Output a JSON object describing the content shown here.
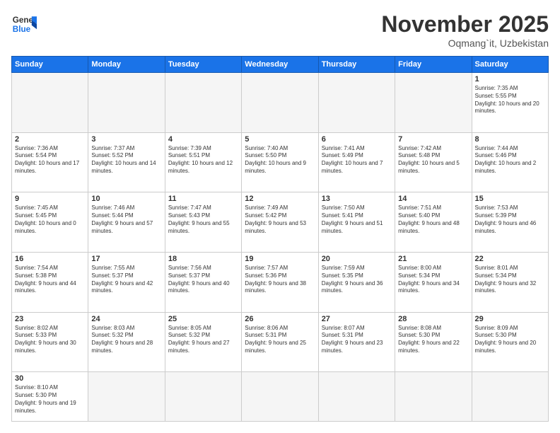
{
  "header": {
    "logo_general": "General",
    "logo_blue": "Blue",
    "month_title": "November 2025",
    "location": "Oqmang`it, Uzbekistan"
  },
  "days_of_week": [
    "Sunday",
    "Monday",
    "Tuesday",
    "Wednesday",
    "Thursday",
    "Friday",
    "Saturday"
  ],
  "weeks": [
    [
      {
        "num": "",
        "info": ""
      },
      {
        "num": "",
        "info": ""
      },
      {
        "num": "",
        "info": ""
      },
      {
        "num": "",
        "info": ""
      },
      {
        "num": "",
        "info": ""
      },
      {
        "num": "",
        "info": ""
      },
      {
        "num": "1",
        "info": "Sunrise: 7:35 AM\nSunset: 5:55 PM\nDaylight: 10 hours and 20 minutes."
      }
    ],
    [
      {
        "num": "2",
        "info": "Sunrise: 7:36 AM\nSunset: 5:54 PM\nDaylight: 10 hours and 17 minutes."
      },
      {
        "num": "3",
        "info": "Sunrise: 7:37 AM\nSunset: 5:52 PM\nDaylight: 10 hours and 14 minutes."
      },
      {
        "num": "4",
        "info": "Sunrise: 7:39 AM\nSunset: 5:51 PM\nDaylight: 10 hours and 12 minutes."
      },
      {
        "num": "5",
        "info": "Sunrise: 7:40 AM\nSunset: 5:50 PM\nDaylight: 10 hours and 9 minutes."
      },
      {
        "num": "6",
        "info": "Sunrise: 7:41 AM\nSunset: 5:49 PM\nDaylight: 10 hours and 7 minutes."
      },
      {
        "num": "7",
        "info": "Sunrise: 7:42 AM\nSunset: 5:48 PM\nDaylight: 10 hours and 5 minutes."
      },
      {
        "num": "8",
        "info": "Sunrise: 7:44 AM\nSunset: 5:46 PM\nDaylight: 10 hours and 2 minutes."
      }
    ],
    [
      {
        "num": "9",
        "info": "Sunrise: 7:45 AM\nSunset: 5:45 PM\nDaylight: 10 hours and 0 minutes."
      },
      {
        "num": "10",
        "info": "Sunrise: 7:46 AM\nSunset: 5:44 PM\nDaylight: 9 hours and 57 minutes."
      },
      {
        "num": "11",
        "info": "Sunrise: 7:47 AM\nSunset: 5:43 PM\nDaylight: 9 hours and 55 minutes."
      },
      {
        "num": "12",
        "info": "Sunrise: 7:49 AM\nSunset: 5:42 PM\nDaylight: 9 hours and 53 minutes."
      },
      {
        "num": "13",
        "info": "Sunrise: 7:50 AM\nSunset: 5:41 PM\nDaylight: 9 hours and 51 minutes."
      },
      {
        "num": "14",
        "info": "Sunrise: 7:51 AM\nSunset: 5:40 PM\nDaylight: 9 hours and 48 minutes."
      },
      {
        "num": "15",
        "info": "Sunrise: 7:53 AM\nSunset: 5:39 PM\nDaylight: 9 hours and 46 minutes."
      }
    ],
    [
      {
        "num": "16",
        "info": "Sunrise: 7:54 AM\nSunset: 5:38 PM\nDaylight: 9 hours and 44 minutes."
      },
      {
        "num": "17",
        "info": "Sunrise: 7:55 AM\nSunset: 5:37 PM\nDaylight: 9 hours and 42 minutes."
      },
      {
        "num": "18",
        "info": "Sunrise: 7:56 AM\nSunset: 5:37 PM\nDaylight: 9 hours and 40 minutes."
      },
      {
        "num": "19",
        "info": "Sunrise: 7:57 AM\nSunset: 5:36 PM\nDaylight: 9 hours and 38 minutes."
      },
      {
        "num": "20",
        "info": "Sunrise: 7:59 AM\nSunset: 5:35 PM\nDaylight: 9 hours and 36 minutes."
      },
      {
        "num": "21",
        "info": "Sunrise: 8:00 AM\nSunset: 5:34 PM\nDaylight: 9 hours and 34 minutes."
      },
      {
        "num": "22",
        "info": "Sunrise: 8:01 AM\nSunset: 5:34 PM\nDaylight: 9 hours and 32 minutes."
      }
    ],
    [
      {
        "num": "23",
        "info": "Sunrise: 8:02 AM\nSunset: 5:33 PM\nDaylight: 9 hours and 30 minutes."
      },
      {
        "num": "24",
        "info": "Sunrise: 8:03 AM\nSunset: 5:32 PM\nDaylight: 9 hours and 28 minutes."
      },
      {
        "num": "25",
        "info": "Sunrise: 8:05 AM\nSunset: 5:32 PM\nDaylight: 9 hours and 27 minutes."
      },
      {
        "num": "26",
        "info": "Sunrise: 8:06 AM\nSunset: 5:31 PM\nDaylight: 9 hours and 25 minutes."
      },
      {
        "num": "27",
        "info": "Sunrise: 8:07 AM\nSunset: 5:31 PM\nDaylight: 9 hours and 23 minutes."
      },
      {
        "num": "28",
        "info": "Sunrise: 8:08 AM\nSunset: 5:30 PM\nDaylight: 9 hours and 22 minutes."
      },
      {
        "num": "29",
        "info": "Sunrise: 8:09 AM\nSunset: 5:30 PM\nDaylight: 9 hours and 20 minutes."
      }
    ],
    [
      {
        "num": "30",
        "info": "Sunrise: 8:10 AM\nSunset: 5:30 PM\nDaylight: 9 hours and 19 minutes."
      },
      {
        "num": "",
        "info": ""
      },
      {
        "num": "",
        "info": ""
      },
      {
        "num": "",
        "info": ""
      },
      {
        "num": "",
        "info": ""
      },
      {
        "num": "",
        "info": ""
      },
      {
        "num": "",
        "info": ""
      }
    ]
  ]
}
